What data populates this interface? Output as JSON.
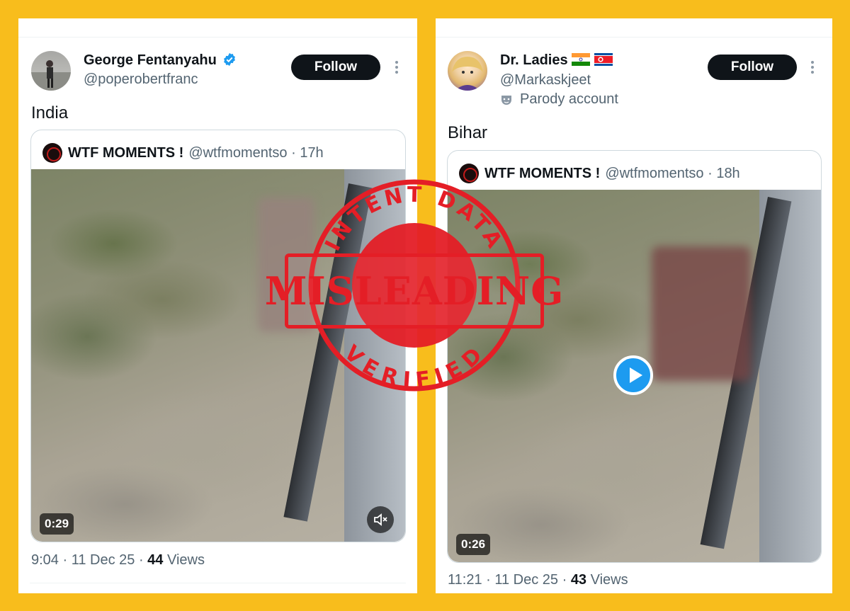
{
  "left_tweet": {
    "name": "George Fentanyahu",
    "handle": "@poperobertfranc",
    "follow_label": "Follow",
    "text": "India",
    "quote": {
      "name": "WTF MOMENTS !",
      "meta": "@wtfmomentso · 17h"
    },
    "video_duration": "0:29",
    "time": "9:04 · 11 Dec 25 ·",
    "views_count": "44",
    "views_label": "Views"
  },
  "right_tweet": {
    "name": "Dr. Ladies",
    "handle": "@Markaskjeet",
    "parody_label": "Parody account",
    "follow_label": "Follow",
    "text": "Bihar",
    "quote": {
      "name": "WTF MOMENTS !",
      "meta": "@wtfmomentso · 18h"
    },
    "video_duration": "0:26",
    "time": "11:21 · 11 Dec 25 ·",
    "views_count": "43",
    "views_label": "Views"
  },
  "stamp": {
    "top_text": "INTENT DATA",
    "main_text": "MISLEADING",
    "bottom_text": "VERIFIED",
    "color": "#e41e26"
  },
  "colors": {
    "background": "#f8bd1c",
    "verified": "#1d9bf0",
    "play": "#1d9bf0"
  },
  "icons": [
    "verified-badge-icon",
    "more-icon",
    "mute-icon",
    "play-icon",
    "parody-mask-icon",
    "india-flag-icon",
    "north-korea-flag-icon"
  ]
}
